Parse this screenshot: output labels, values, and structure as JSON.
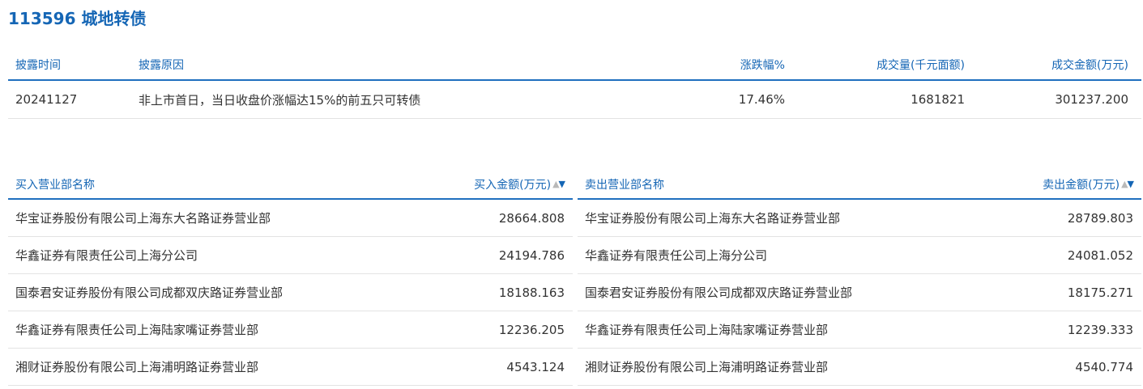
{
  "title": "113596 城地转债",
  "disclosure": {
    "headers": {
      "time": "披露时间",
      "reason": "披露原因",
      "change_pct": "涨跌幅%",
      "volume": "成交量(千元面额)",
      "amount": "成交金额(万元)"
    },
    "rows": [
      {
        "time": "20241127",
        "reason": "非上市首日，当日收盘价涨幅达15%的前五只可转债",
        "change_pct": "17.46%",
        "volume": "1681821",
        "amount": "301237.200"
      }
    ]
  },
  "buy": {
    "header_name": "买入营业部名称",
    "header_amount": "买入金额(万元)",
    "sort_up": "▲",
    "sort_down": "▼",
    "rows": [
      {
        "name": "华宝证券股份有限公司上海东大名路证券营业部",
        "amount": "28664.808"
      },
      {
        "name": "华鑫证券有限责任公司上海分公司",
        "amount": "24194.786"
      },
      {
        "name": "国泰君安证券股份有限公司成都双庆路证券营业部",
        "amount": "18188.163"
      },
      {
        "name": "华鑫证券有限责任公司上海陆家嘴证券营业部",
        "amount": "12236.205"
      },
      {
        "name": "湘财证券股份有限公司上海浦明路证券营业部",
        "amount": "4543.124"
      }
    ]
  },
  "sell": {
    "header_name": "卖出营业部名称",
    "header_amount": "卖出金额(万元)",
    "sort_up": "▲",
    "sort_down": "▼",
    "rows": [
      {
        "name": "华宝证券股份有限公司上海东大名路证券营业部",
        "amount": "28789.803"
      },
      {
        "name": "华鑫证券有限责任公司上海分公司",
        "amount": "24081.052"
      },
      {
        "name": "国泰君安证券股份有限公司成都双庆路证券营业部",
        "amount": "18175.271"
      },
      {
        "name": "华鑫证券有限责任公司上海陆家嘴证券营业部",
        "amount": "12239.333"
      },
      {
        "name": "湘财证券股份有限公司上海浦明路证券营业部",
        "amount": "4540.774"
      }
    ]
  },
  "colors": {
    "accent": "#1566b5",
    "rule": "#1f6fbf",
    "row_border": "#e3e3e3",
    "text": "#333333"
  }
}
